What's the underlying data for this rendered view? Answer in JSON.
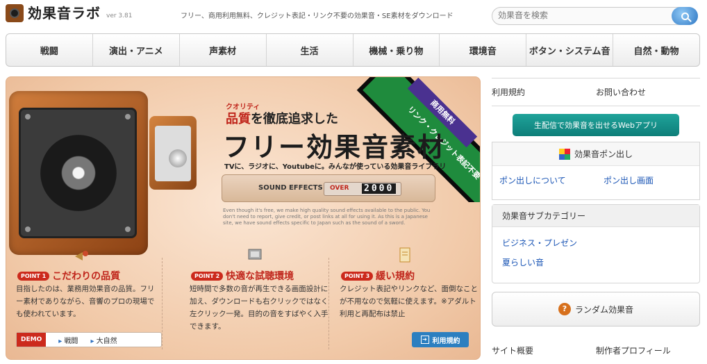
{
  "header": {
    "logo_text": "効果音ラボ",
    "version": "ver 3.81",
    "tagline": "フリー、商用利用無料、クレジット表記・リンク不要の効果音・SE素材をダウンロード",
    "search_placeholder": "効果音を検索"
  },
  "nav": {
    "items": [
      "戦闘",
      "演出・アニメ",
      "声素材",
      "生活",
      "機械・乗り物",
      "環境音",
      "ボタン・システム音",
      "自然・動物"
    ]
  },
  "hero": {
    "ribbon_top": "商用無料",
    "ribbon_main": "リンク・クレジット表記不要",
    "kicker": "クオリティ",
    "headline1_em": "品質",
    "headline1_rest": "を徹底追求した",
    "headline2": "フリー効果音素材",
    "subline": "TVに、ラジオに、Youtubeに。みんなが使っている効果音ライブラリ",
    "counter_label": "SOUND EFFECTS",
    "counter_over": "OVER",
    "counter_num": "2000",
    "english": "Even though it's free, we make high quality sound effects available to the public. You don't need to report, give credit, or post links at all for using it. As this is a Japanese site, we have sound effects specific to Japan such as the sound of a sword.",
    "points": [
      {
        "badge": "POINT 1",
        "title": "こだわりの品質",
        "text": "目指したのは、業務用効果音の品質。フリー素材でありながら、音響のプロの現場でも使われています。"
      },
      {
        "badge": "POINT 2",
        "title": "快適な試聴環境",
        "text": "短時間で多数の音が再生できる画面設計に加え、ダウンロードも右クリックではなく左クリック一発。目的の音をすばやく入手できます。"
      },
      {
        "badge": "POINT 3",
        "title": "緩い規約",
        "text": "クレジット表記やリンクなど、面倒なことが不用なので気軽に使えます。※アダルト利用と再配布は禁止"
      }
    ],
    "demo_label": "DEMO",
    "demo_links": [
      "戦闘",
      "大自然"
    ],
    "terms_button": "利用規約"
  },
  "sidebar": {
    "terms": "利用規約",
    "contact": "お問い合わせ",
    "webapp": "生配信で効果音を出せるWebアプリ",
    "pon_title": "効果音ポン出し",
    "pon_about": "ポン出しについて",
    "pon_screen": "ポン出し画面",
    "subcat_title": "効果音サブカテゴリー",
    "subcats": [
      "ビジネス・プレゼン",
      "夏らしい音"
    ],
    "random": "ランダム効果音",
    "site_overview": "サイト概要",
    "author_profile": "制作者プロフィール"
  }
}
